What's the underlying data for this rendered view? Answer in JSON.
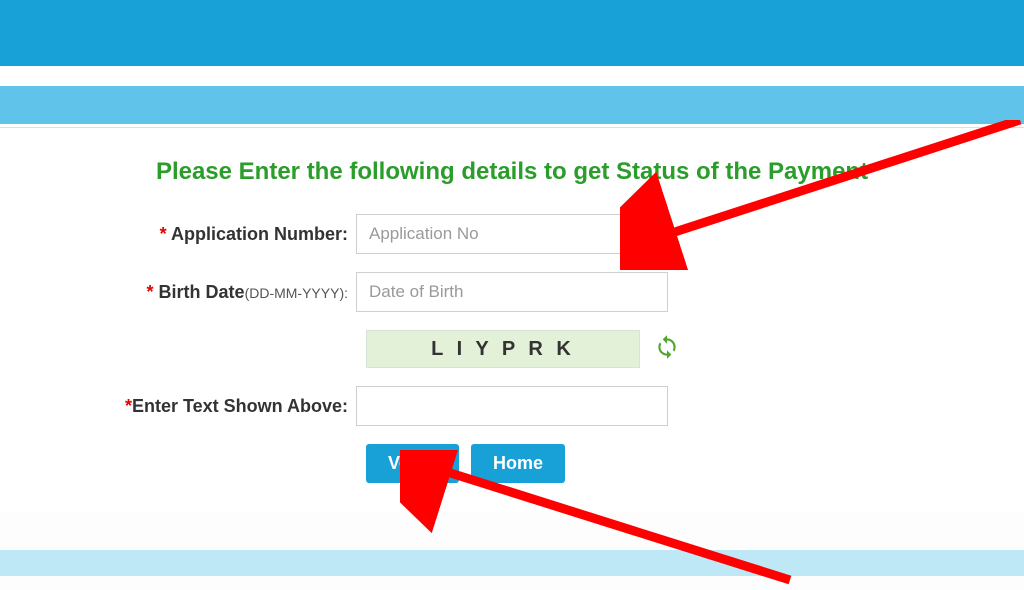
{
  "heading": "Please Enter the following details to get Status of the Payment",
  "labels": {
    "application_number": "Application Number:",
    "birth_date": "Birth Date",
    "birth_date_hint": "(DD-MM-YYYY):",
    "captcha": "Enter Text Shown Above:"
  },
  "placeholders": {
    "application_number": "Application No",
    "birth_date": "Date of Birth"
  },
  "captcha_value": "L I Y P R K",
  "buttons": {
    "verify": "Verify",
    "home": "Home"
  },
  "required_marker": "* "
}
